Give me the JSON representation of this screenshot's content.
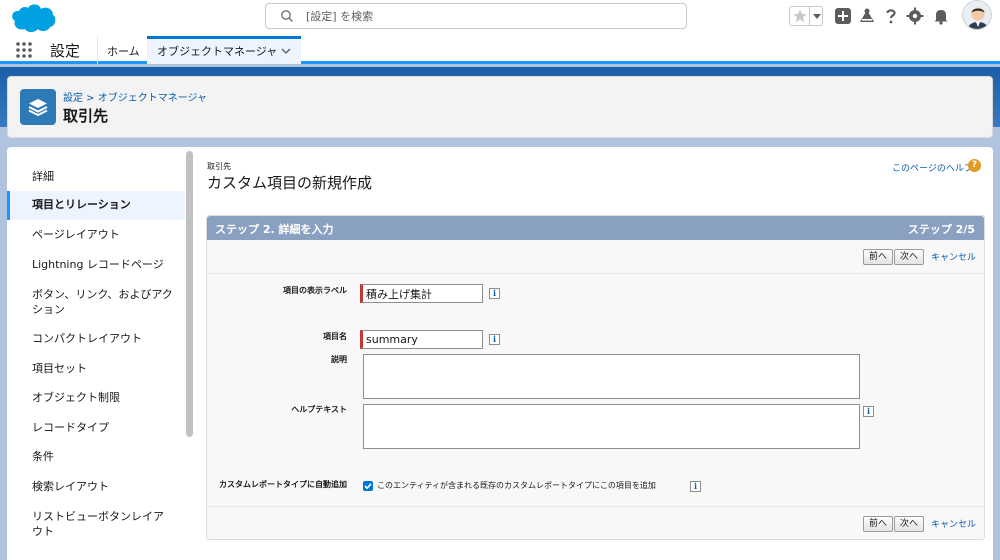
{
  "header": {
    "search_placeholder": "[設定] を検索"
  },
  "nav": {
    "app_name": "設定",
    "home": "ホーム",
    "active_tab": "オブジェクトマネージャ"
  },
  "page_header": {
    "breadcrumb_root": "設定",
    "breadcrumb_sep": " > ",
    "breadcrumb_child": "オブジェクトマネージャ",
    "title": "取引先"
  },
  "sidebar": {
    "items": [
      {
        "label": "詳細"
      },
      {
        "label": "項目とリレーション"
      },
      {
        "label": "ページレイアウト"
      },
      {
        "label": "Lightning レコードページ"
      },
      {
        "label": "ボタン、リンク、およびアク"
      },
      {
        "label": "ション"
      },
      {
        "label": "コンパクトレイアウト"
      },
      {
        "label": "項目セット"
      },
      {
        "label": "オブジェクト制限"
      },
      {
        "label": "レコードタイプ"
      },
      {
        "label": "条件"
      },
      {
        "label": "検索レイアウト"
      },
      {
        "label": "リストビューボタンレイア"
      },
      {
        "label": "ウト"
      }
    ]
  },
  "main": {
    "crumb": "取引先",
    "title": "カスタム項目の新規作成",
    "help_link": "このページのヘルプ",
    "help_icon": "?",
    "step_title": "ステップ 2. 詳細を入力",
    "step_count": "ステップ 2/5",
    "prev_label": "前へ",
    "next_label": "次へ",
    "cancel_label": "キャンセル",
    "info_glyph": "i"
  },
  "form": {
    "label_field": {
      "label": "項目の表示ラベル",
      "value": "積み上げ集計"
    },
    "name_field": {
      "label": "項目名",
      "value": "summary"
    },
    "description": {
      "label": "説明",
      "value": ""
    },
    "help_text": {
      "label": "ヘルプテキスト",
      "value": ""
    },
    "report_auto_add": {
      "label": "カスタムレポートタイプに自動追加",
      "checkbox_label": "このエンティティが含まれる既存のカスタムレポートタイプにこの項目を追加",
      "checked": true
    }
  },
  "colors": {
    "brand_blue": "#0176d3",
    "step_bar": "#8aa0c0",
    "required_red": "#c23934",
    "help_orange": "#e29a1f"
  }
}
